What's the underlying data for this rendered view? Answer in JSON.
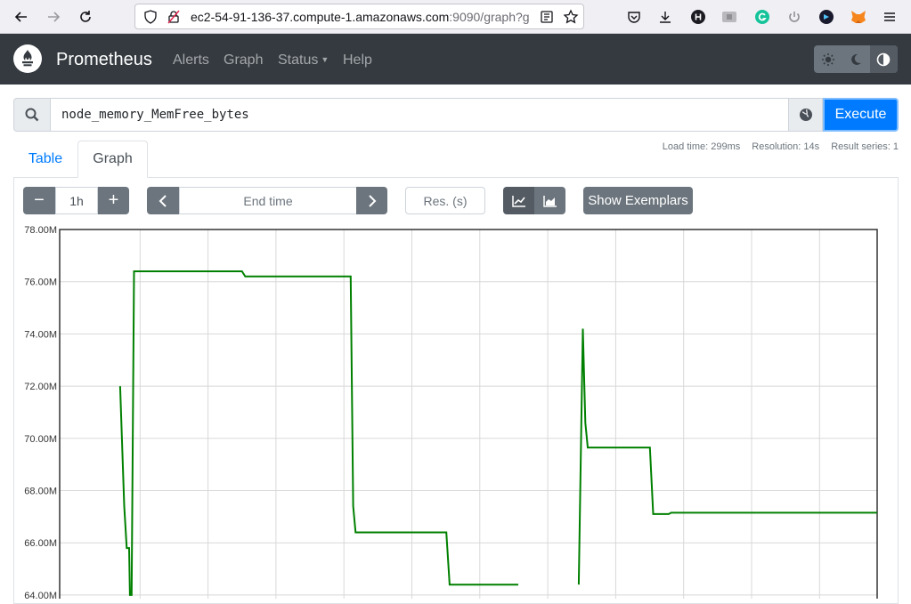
{
  "browser": {
    "url_main": "ec2-54-91-136-37.compute-1.amazonaws.com",
    "url_port_path": ":9090/graph?g"
  },
  "navbar": {
    "brand": "Prometheus",
    "links": [
      "Alerts",
      "Graph",
      "Status",
      "Help"
    ]
  },
  "query": {
    "expression": "node_memory_MemFree_bytes",
    "execute_label": "Execute"
  },
  "stats": {
    "load_time": "Load time: 299ms",
    "resolution": "Resolution: 14s",
    "result_series": "Result series: 1"
  },
  "tabs": {
    "table": "Table",
    "graph": "Graph"
  },
  "controls": {
    "minus": "−",
    "range": "1h",
    "plus": "+",
    "end_time_placeholder": "End time",
    "resolution_placeholder": "Res. (s)",
    "show_exemplars": "Show Exemplars"
  },
  "colors": {
    "series": "#008000",
    "navbar": "#343a40",
    "primary": "#007bff"
  },
  "chart_data": {
    "type": "line",
    "ylim": [
      64,
      78
    ],
    "yticks": [
      "64.00M",
      "66.00M",
      "68.00M",
      "70.00M",
      "72.00M",
      "74.00M",
      "76.00M",
      "78.00M"
    ],
    "grid": true,
    "series": [
      {
        "values_segments": [
          [
            [
              0.074,
              72.0
            ],
            [
              0.079,
              67.4
            ],
            [
              0.082,
              65.8
            ],
            [
              0.085,
              65.8
            ],
            [
              0.086,
              64.0
            ],
            [
              0.088,
              64.0
            ],
            [
              0.091,
              76.4
            ],
            [
              0.223,
              76.4
            ],
            [
              0.227,
              76.2
            ],
            [
              0.356,
              76.2
            ],
            [
              0.359,
              67.4
            ],
            [
              0.362,
              66.4
            ],
            [
              0.473,
              66.4
            ],
            [
              0.477,
              64.4
            ],
            [
              0.561,
              64.4
            ]
          ],
          [
            [
              0.635,
              64.4
            ],
            [
              0.64,
              74.2
            ],
            [
              0.643,
              70.6
            ],
            [
              0.646,
              69.65
            ],
            [
              0.722,
              69.65
            ],
            [
              0.726,
              67.1
            ],
            [
              0.745,
              67.1
            ],
            [
              0.748,
              67.15
            ],
            [
              1.0,
              67.15
            ]
          ]
        ]
      }
    ]
  }
}
